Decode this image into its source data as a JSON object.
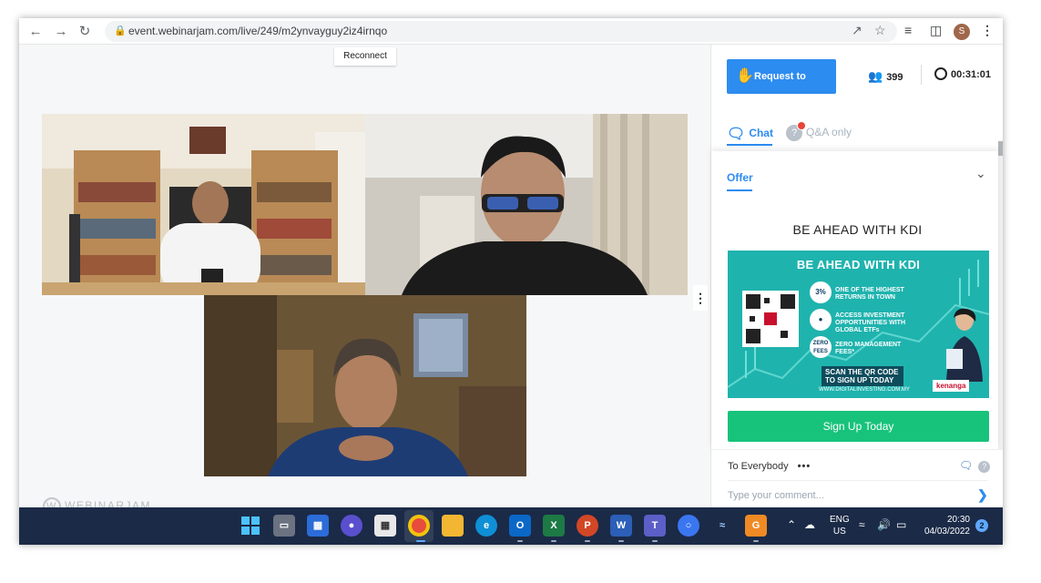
{
  "browser": {
    "url": "event.webinarjam.com/live/249/m2ynvayguy2iz4irnqo",
    "profile_initial": "S",
    "icons": [
      "back-icon",
      "forward-icon",
      "reload-icon",
      "lock-icon",
      "share-icon",
      "star-icon",
      "reading-list-icon",
      "side-panel-icon",
      "menu-icon"
    ]
  },
  "stage": {
    "reconnect_label": "Reconnect",
    "logo_text": "WEBINARJAM"
  },
  "panel": {
    "request_to_speak": "Request to speak",
    "attendee_count": "399",
    "elapsed_time": "00:31:01",
    "tabs": {
      "chat": "Chat",
      "qa": "Q&A only"
    },
    "offer": {
      "tab_label": "Offer",
      "title": "BE AHEAD WITH KDI",
      "banner": {
        "heading": "BE AHEAD WITH KDI",
        "item1_badge": "3%",
        "item1_text": "ONE OF THE HIGHEST RETURNS IN TOWN",
        "item2_text": "ACCESS INVESTMENT OPPORTUNITIES WITH GLOBAL ETFs",
        "item3_badge": "ZERO FEES",
        "item3_text": "ZERO MANAGEMENT FEES*",
        "scan_text": "SCAN THE QR CODE TO SIGN UP TODAY",
        "url": "WWW.DIGITALINVESTING.COM.MY",
        "brand": "kenanga"
      },
      "signup_label": "Sign Up Today"
    },
    "chat_footer": {
      "recipient": "To Everybody",
      "comment_placeholder": "Type your comment..."
    }
  },
  "taskbar": {
    "language_line1": "ENG",
    "language_line2": "US",
    "time": "20:30",
    "date": "04/03/2022",
    "notification_count": "2",
    "apps": [
      "start",
      "task-view",
      "widgets",
      "zoom",
      "store",
      "chrome",
      "file-explorer",
      "edge",
      "outlook",
      "excel",
      "powerpoint",
      "word",
      "teams",
      "signal",
      "app-blue",
      "app-orange"
    ]
  },
  "colors": {
    "accent_blue": "#2d8cf0",
    "signup_green": "#17c37b",
    "banner_teal": "#1fb3ae",
    "taskbar_bg": "#1b2a47"
  }
}
